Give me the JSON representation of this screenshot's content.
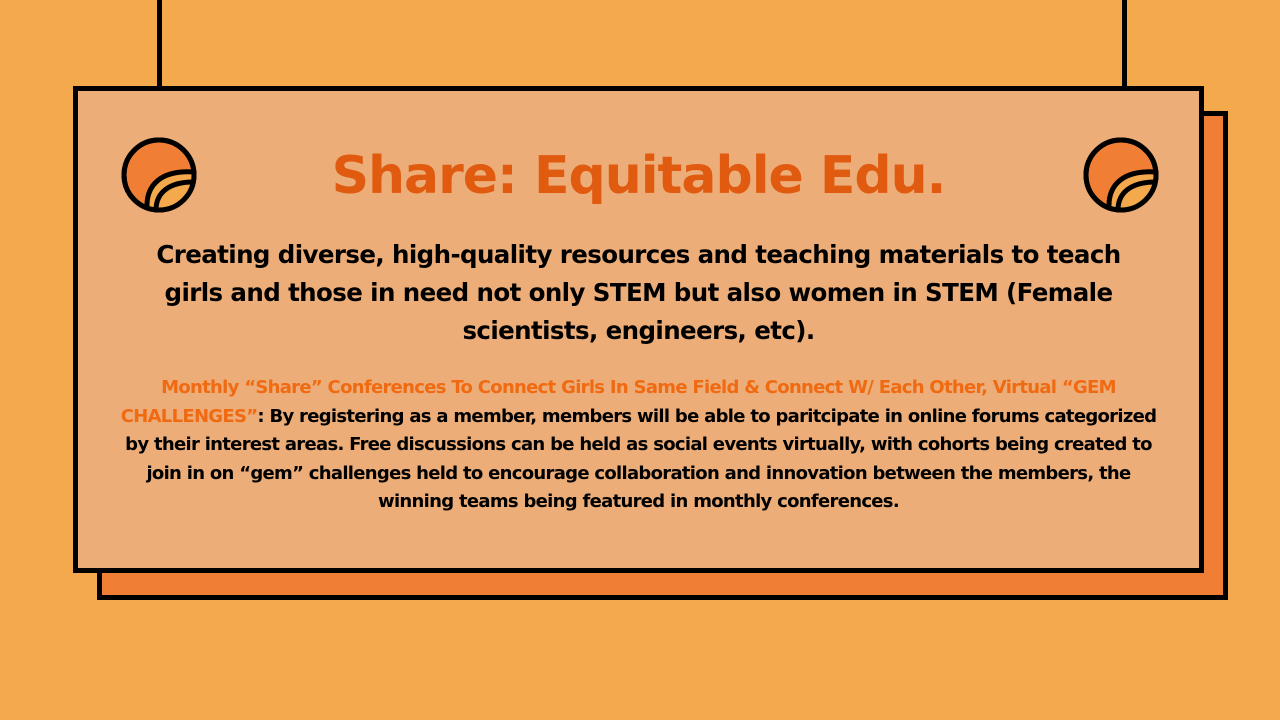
{
  "slide": {
    "title": "Share: Equitable Edu.",
    "subtitle": "Creating diverse, high-quality resources and teaching materials to teach girls and those in need not only STEM but also women in STEM (Female scientists, engineers, etc).",
    "body_highlight": "Monthly “Share” Conferences To Connect Girls In Same Field & Connect W/ Each Other, Virtual “GEM CHALLENGES”",
    "body_text": ": By registering as a member, members will be able to paritcipate in online forums categorized by their interest areas. Free discussions can be held as social events virtually, with cohorts being created to join in on “gem” challenges held to encourage collaboration and innovation between the members, the winning teams being featured in monthly conferences."
  },
  "colors": {
    "background": "#F5A94D",
    "card": "#ECAD78",
    "card_shadow": "#F07F35",
    "title": "#E05A10",
    "highlight": "#F06A12",
    "outline": "#000000"
  },
  "icons": {
    "ornament": "circle-ornament-icon",
    "string": "hanging-string"
  }
}
